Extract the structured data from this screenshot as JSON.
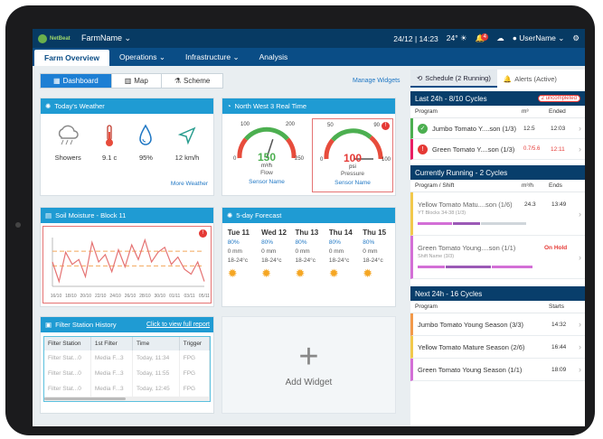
{
  "topbar": {
    "logo_text": "NetBeat",
    "farm_name": "FarmName",
    "date": "24/12",
    "time": "14:23",
    "temp": "24°",
    "notif_count": "4",
    "user": "UserName"
  },
  "menu": [
    {
      "label": "Farm Overview"
    },
    {
      "label": "Operations"
    },
    {
      "label": "Infrastructure"
    },
    {
      "label": "Analysis"
    }
  ],
  "tabs": [
    {
      "label": "Dashboard"
    },
    {
      "label": "Map"
    },
    {
      "label": "Scheme"
    }
  ],
  "manage_widgets": "Manage Widgets",
  "weather": {
    "title": "Today's Weather",
    "items": [
      {
        "icon": "cloud-rain-icon",
        "value": "Showers"
      },
      {
        "icon": "thermometer-icon",
        "value": "9.1 c"
      },
      {
        "icon": "humidity-icon",
        "value": "95%"
      },
      {
        "icon": "wind-direction-icon",
        "value": "12 km/h"
      }
    ],
    "more": "More Weather"
  },
  "realtime": {
    "title": "North West 3 Real Time",
    "gauges": [
      {
        "min": "0",
        "max": "250",
        "lo": "100",
        "hi": "200",
        "value": "150",
        "unit": "m³/h",
        "label": "Flow",
        "sensor": "Sensor Name",
        "level": 0.6
      },
      {
        "min": "0",
        "max": "100",
        "lo": "50",
        "hi": "90",
        "value": "100",
        "unit": "psi",
        "label": "Pressure",
        "sensor": "Sensor Name",
        "level": 1.0,
        "alert": "!"
      }
    ]
  },
  "soil": {
    "title": "Soil Moisture - Block 11",
    "alert": "!",
    "chart_data": {
      "type": "line",
      "x": [
        "16/10",
        "18/10",
        "20/10",
        "22/10",
        "24/10",
        "26/10",
        "28/10",
        "30/10",
        "01/11",
        "03/11",
        "05/11"
      ],
      "series": [
        {
          "values": [
            0.5,
            0.1,
            0.7,
            0.45,
            0.55,
            0.2,
            0.9,
            0.5,
            0.65,
            0.3,
            0.75,
            0.4,
            0.85,
            0.55,
            0.95,
            0.5,
            0.7,
            0.8,
            0.45,
            0.6,
            0.35,
            0.25,
            0.5,
            0.1
          ]
        }
      ],
      "thresholds": [
        0.72,
        0.42
      ]
    }
  },
  "forecast": {
    "title": "5-day Forecast",
    "days": [
      {
        "name": "Tue 11",
        "pct": "80%",
        "rain": "0 mm",
        "range": "18-24°c"
      },
      {
        "name": "Wed 12",
        "pct": "80%",
        "rain": "0 mm",
        "range": "18-24°c"
      },
      {
        "name": "Thu 13",
        "pct": "80%",
        "rain": "0 mm",
        "range": "18-24°c"
      },
      {
        "name": "Thu 14",
        "pct": "80%",
        "rain": "0 mm",
        "range": "18-24°c"
      },
      {
        "name": "Thu 15",
        "pct": "80%",
        "rain": "0 mm",
        "range": "18-24°c"
      }
    ]
  },
  "filter": {
    "title": "Filter Station History",
    "link": "Click to view full report",
    "headers": [
      "Filter Station",
      "1st Filter",
      "Time",
      "Trigger"
    ],
    "rows": [
      [
        "Filter Stat...0",
        "Media F...3",
        "Today, 11:34",
        "FPG"
      ],
      [
        "Filter Stat...0",
        "Media F...3",
        "Today, 11:55",
        "FPG"
      ],
      [
        "Filter Stat...0",
        "Media F...3",
        "Today, 12:45",
        "FPG"
      ]
    ]
  },
  "add_widget": "Add Widget",
  "right": {
    "tabs": [
      {
        "label": "Schedule (2 Running)"
      },
      {
        "label": "Alerts (Active)"
      }
    ],
    "last24": {
      "title": "Last 24h - 8/10 Cycles",
      "pill": "2 uncompleted",
      "headers": [
        "Program",
        "m³",
        "Ended"
      ],
      "rows": [
        {
          "name": "Jumbo Tomato Y....son (1/3)",
          "m3": "12.5",
          "time": "12:03",
          "status": "ok"
        },
        {
          "name": "Green Tomato Y....son (1/3)",
          "m3": "0.7/5.6",
          "time": "12:11",
          "status": "error"
        }
      ]
    },
    "running": {
      "title": "Currently Running - 2 Cycles",
      "headers": [
        "Program / Shift",
        "m³/h",
        "Ends"
      ],
      "rows": [
        {
          "name": "Yellow Tomato Matu....son (1/6)",
          "sub": "YT Blocks 34-38 (1/3)",
          "rate": "24.3",
          "time": "13:49"
        },
        {
          "name": "Green Tomato Young....son (1/1)",
          "sub": "Shift Name (3/3)",
          "rate": "",
          "time": "On Hold"
        }
      ]
    },
    "next24": {
      "title": "Next 24h - 16 Cycles",
      "headers": [
        "Program",
        "Starts"
      ],
      "rows": [
        {
          "name": "Jumbo Tomato Young Season (3/3)",
          "time": "14:32",
          "color": "#f2994a"
        },
        {
          "name": "Yellow Tomato Mature Season (2/6)",
          "time": "16:44",
          "color": "#f2c94c"
        },
        {
          "name": "Green Tomato Young Season (1/1)",
          "time": "18:09",
          "color": "#d36fd6"
        }
      ]
    }
  }
}
